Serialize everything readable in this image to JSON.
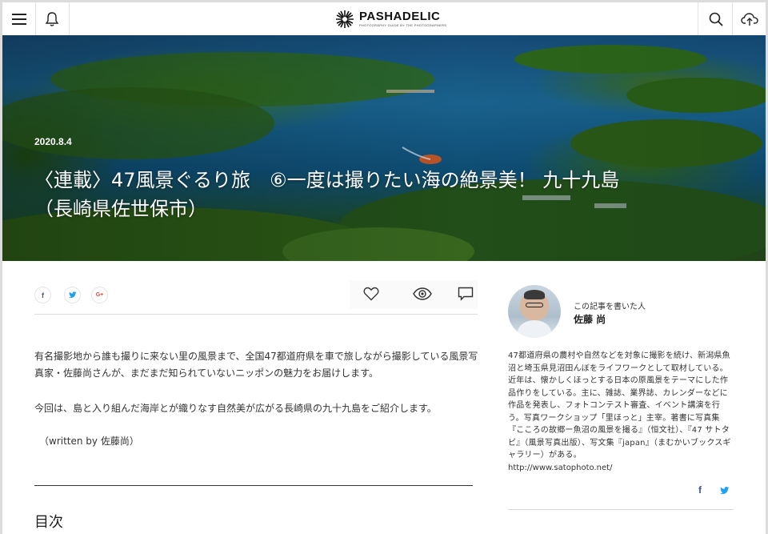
{
  "header": {
    "logo_name": "PASHADELIC",
    "logo_tagline": "PHOTOGRAPHY GUIDE BY THE PHOTOGRAPHERS"
  },
  "hero": {
    "date": "2020.8.4",
    "title_line1": "〈連載〉47風景ぐるり旅　⑥一度は撮りたい海の絶景美！ 九十九島",
    "title_line2": "（長崎県佐世保市）"
  },
  "share": {
    "facebook": "f",
    "twitter": "t",
    "google": "G+"
  },
  "article": {
    "para1": "有名撮影地から誰も撮りに来ない里の風景まで、全国47都道府県を車で旅しながら撮影している風景写真家・佐藤尚さんが、まだまだ知られていないニッポンの魅力をお届けします。",
    "para2": "今回は、島と入り組んだ海岸とが織りなす自然美が広がる長崎県の九十九島をご紹介します。",
    "byline": "（written by 佐藤尚）",
    "toc_heading": "目次"
  },
  "author": {
    "label": "この記事を書いた人",
    "name": "佐藤 尚",
    "bio": "47都道府県の農村や自然などを対象に撮影を続け、新潟県魚沼と埼玉県見沼田んぼをライフワークとして取材している。近年は、懐かしくほっとする日本の原風景をテーマにした作品作りをしている。主に、雑誌、業界誌、カレンダーなどに作品を発表し、フォトコンテスト審査、イベント講演を行う。写真ワークショップ「里ほっと」主宰。著書に写真集『こころの故郷ー魚沼の風景を撮る』（恒文社）、『47 サトタビ』（風景写真出版）、写文集『japan』（まむかいブックスギャラリー）がある。",
    "website": "http://www.satophoto.net/"
  },
  "colors": {
    "facebook": "#3b5998",
    "twitter": "#1da1f2",
    "google": "#dd4b39"
  }
}
